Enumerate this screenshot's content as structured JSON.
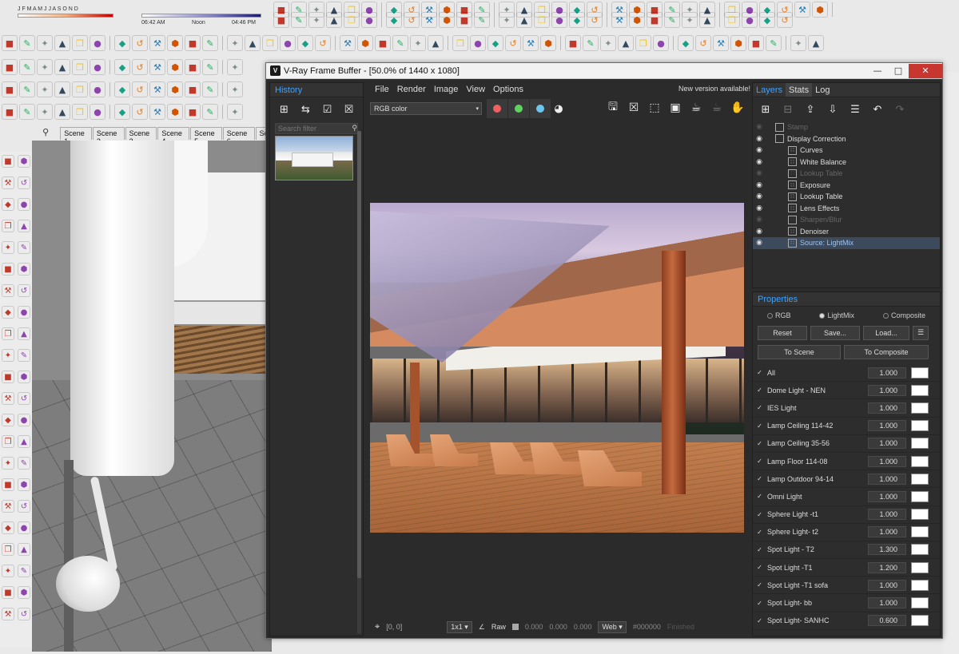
{
  "sketchup": {
    "months": "J F M A M J J A S O N D",
    "time_start": "06:42 AM",
    "time_noon": "Noon",
    "time_end": "04:46 PM",
    "scene_tabs": [
      "Scene 1",
      "Scene 2",
      "Scene 3",
      "Scene 4",
      "Scene 5",
      "Scene 6",
      "Sc"
    ]
  },
  "vfb": {
    "title": "V-Ray Frame Buffer - [50.0% of 1440 x 1080]",
    "logo": "V",
    "menu": [
      "File",
      "Render",
      "Image",
      "View",
      "Options"
    ],
    "new_version": "New version available!",
    "channel": "RGB color",
    "history": {
      "title": "History",
      "search_placeholder": "Search filter"
    },
    "status": {
      "coords": "[0, 0]",
      "zoom": "1x1",
      "raw_label": "Raw",
      "r": "0.000",
      "g": "0.000",
      "b": "0.000",
      "colorspace": "Web",
      "hex": "#000000",
      "state": "Finished"
    },
    "layers_panel": {
      "tabs": [
        "Layers",
        "Stats",
        "Log"
      ],
      "items": [
        {
          "label": "Stamp",
          "visible": false,
          "indent": 1,
          "disabled": true
        },
        {
          "label": "Display Correction",
          "visible": true,
          "indent": 1,
          "disabled": false
        },
        {
          "label": "Curves",
          "visible": true,
          "indent": 2,
          "disabled": false
        },
        {
          "label": "White Balance",
          "visible": true,
          "indent": 2,
          "disabled": false
        },
        {
          "label": "Lookup Table",
          "visible": false,
          "indent": 2,
          "disabled": true
        },
        {
          "label": "Exposure",
          "visible": true,
          "indent": 2,
          "disabled": false
        },
        {
          "label": "Lookup Table",
          "visible": true,
          "indent": 2,
          "disabled": false
        },
        {
          "label": "Lens Effects",
          "visible": true,
          "indent": 2,
          "disabled": false
        },
        {
          "label": "Sharpen/Blur",
          "visible": false,
          "indent": 2,
          "disabled": true
        },
        {
          "label": "Denoiser",
          "visible": true,
          "indent": 2,
          "disabled": false
        },
        {
          "label": "Source: LightMix",
          "visible": true,
          "indent": 2,
          "disabled": false,
          "selected": true
        }
      ]
    },
    "properties": {
      "title": "Properties",
      "modes": [
        "RGB",
        "LightMix",
        "Composite"
      ],
      "active_mode": "LightMix",
      "reset": "Reset",
      "save": "Save...",
      "load": "Load...",
      "to_scene": "To Scene",
      "to_composite": "To Composite",
      "lights": [
        {
          "name": "All",
          "value": "1.000"
        },
        {
          "name": "Dome Light - NEN",
          "value": "1.000"
        },
        {
          "name": "IES Light",
          "value": "1.000"
        },
        {
          "name": "Lamp Ceiling 114-42",
          "value": "1.000"
        },
        {
          "name": "Lamp Ceiling 35-56",
          "value": "1.000"
        },
        {
          "name": "Lamp Floor 114-08",
          "value": "1.000"
        },
        {
          "name": "Lamp Outdoor 94-14",
          "value": "1.000"
        },
        {
          "name": "Omni Light",
          "value": "1.000"
        },
        {
          "name": "Sphere Light -t1",
          "value": "1.000"
        },
        {
          "name": "Sphere Light- t2",
          "value": "1.000"
        },
        {
          "name": "Spot Light - T2",
          "value": "1.300"
        },
        {
          "name": "Spot Light -T1",
          "value": "1.200"
        },
        {
          "name": "Spot Light -T1 sofa",
          "value": "1.000"
        },
        {
          "name": "Spot Light- bb",
          "value": "1.000"
        },
        {
          "name": "Spot Light- SANHC",
          "value": "0.600"
        }
      ]
    },
    "colors": {
      "accent": "#3fa2ff",
      "panel_bg": "#2d2d2d",
      "dot_red": "#f06060",
      "dot_green": "#5fd35f",
      "dot_blue": "#6cc6f0"
    }
  }
}
